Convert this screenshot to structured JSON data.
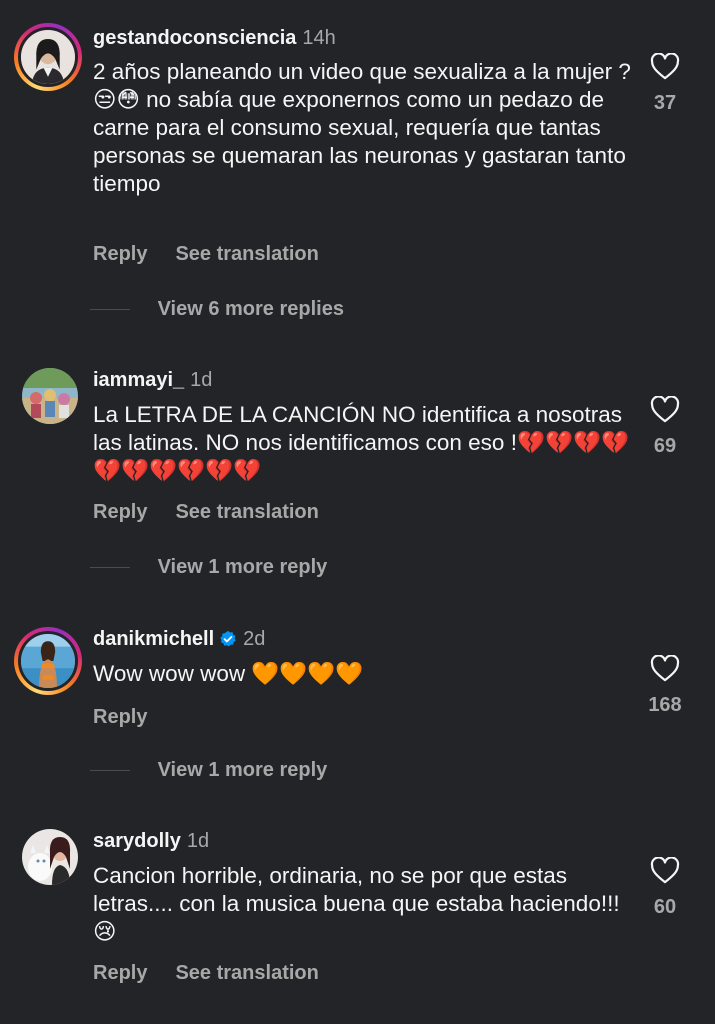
{
  "comments": [
    {
      "username": "gestandoconsciencia",
      "time": "14h",
      "text": "2 años planeando un video que sexualiza a la mujer ? 😒😳 no sabía que exponernos como un pedazo de carne para el consumo sexual, requería que tantas personas se quemaran las neuronas y gastaran tanto tiempo",
      "likes": "37",
      "reply_label": "Reply",
      "translation_label": "See translation",
      "view_more": "View 6 more replies",
      "avatar_icon": "user-avatar-icon",
      "verified": false
    },
    {
      "username": "iammayi_",
      "time": "1d",
      "text": "La LETRA DE LA CANCIÓN NO identifica a nosotras las latinas. NO nos identificamos con eso !💔💔💔💔💔💔💔💔💔💔",
      "likes": "69",
      "reply_label": "Reply",
      "translation_label": "See translation",
      "view_more": "View 1 more reply",
      "avatar_icon": "user-avatar-icon",
      "verified": false
    },
    {
      "username": "danikmichell",
      "time": "2d",
      "text": "Wow wow wow 🧡🧡🧡🧡",
      "likes": "168",
      "reply_label": "Reply",
      "view_more": "View 1 more reply",
      "avatar_icon": "user-avatar-icon",
      "verified": true
    },
    {
      "username": "sarydolly",
      "time": "1d",
      "text": "Cancion horrible, ordinaria, no se por que estas letras.... con la musica buena que estaba haciendo!!!😢",
      "likes": "60",
      "reply_label": "Reply",
      "translation_label": "See translation",
      "avatar_icon": "user-avatar-icon",
      "verified": false
    }
  ],
  "colors": {
    "background": "#232428",
    "text_primary": "#f5f5f5",
    "text_secondary": "#a8a8a8",
    "verified_badge": "#0095f6"
  }
}
